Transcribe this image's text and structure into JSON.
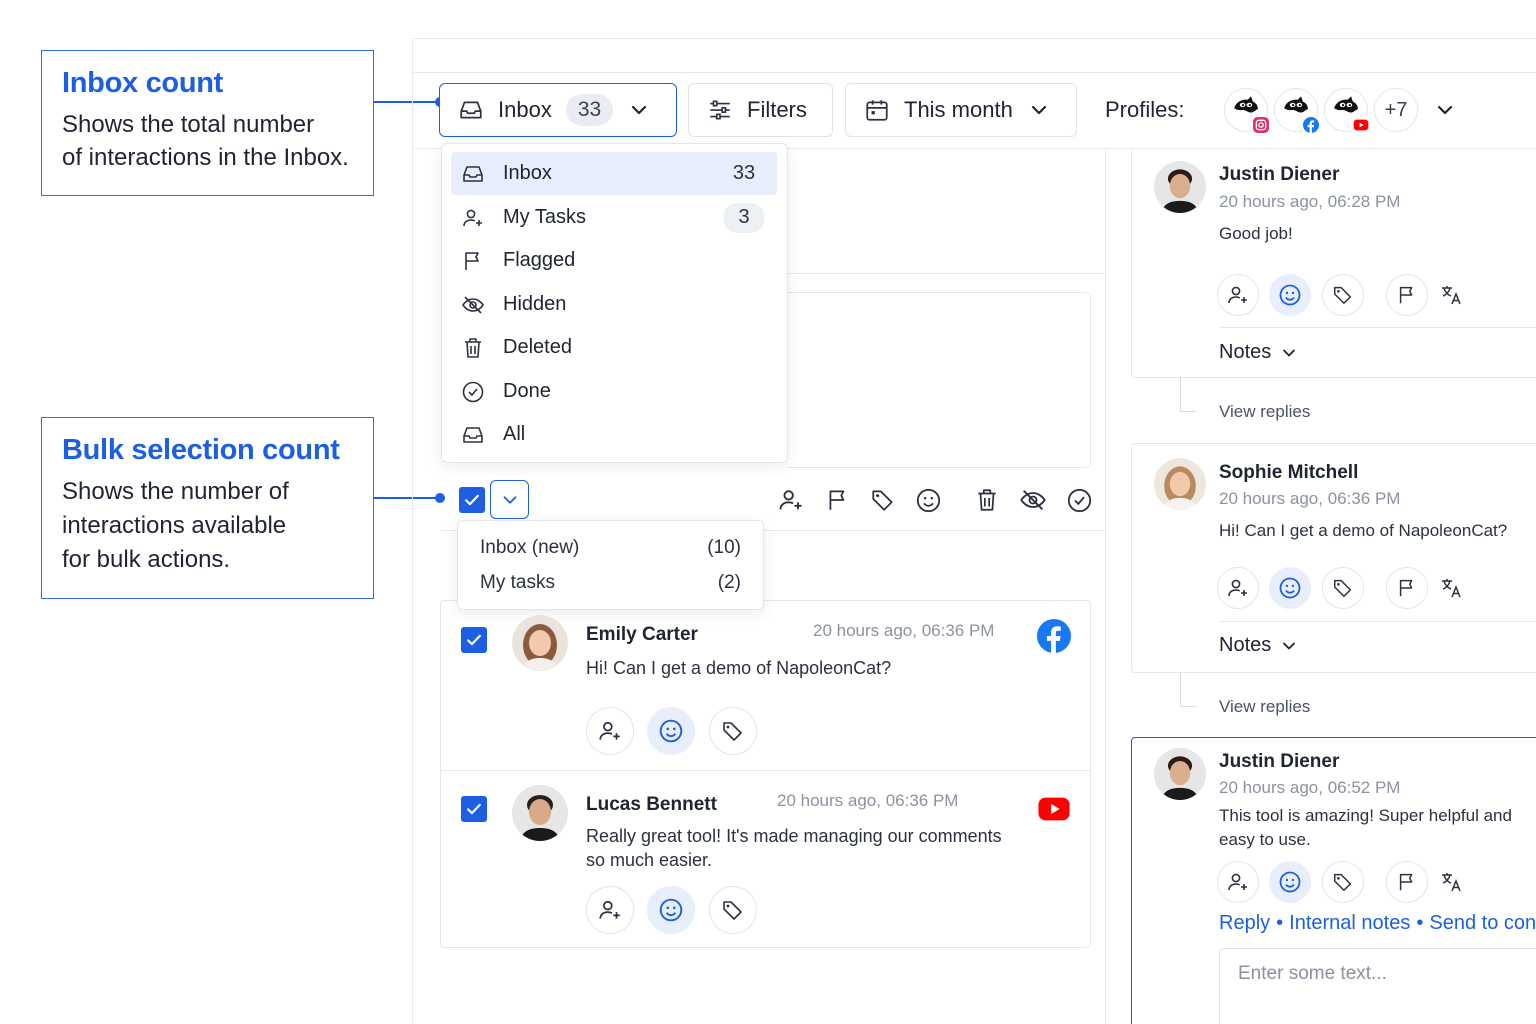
{
  "callouts": {
    "inbox_count": {
      "title": "Inbox count",
      "lines": [
        "Shows the total number",
        "of interactions in the Inbox."
      ]
    },
    "bulk_count": {
      "title": "Bulk selection count",
      "lines": [
        "Shows the number of",
        "interactions available",
        "for bulk actions."
      ]
    }
  },
  "toolbar": {
    "inbox_label": "Inbox",
    "inbox_count": "33",
    "filters_label": "Filters",
    "date_label": "This month",
    "profiles_label": "Profiles:",
    "profiles_more": "+7"
  },
  "inbox_menu": {
    "items": [
      {
        "label": "Inbox",
        "count": "33",
        "icon": "inbox-icon"
      },
      {
        "label": "My Tasks",
        "count": "3",
        "icon": "assign-user-icon"
      },
      {
        "label": "Flagged",
        "count": "",
        "icon": "flag-icon"
      },
      {
        "label": "Hidden",
        "count": "",
        "icon": "eye-off-icon"
      },
      {
        "label": "Deleted",
        "count": "",
        "icon": "trash-icon"
      },
      {
        "label": "Done",
        "count": "",
        "icon": "check-circle-icon"
      },
      {
        "label": "All",
        "count": "",
        "icon": "inbox-icon"
      }
    ]
  },
  "bulk_menu": {
    "items": [
      {
        "label": "Inbox (new)",
        "count": "(10)"
      },
      {
        "label": "My tasks",
        "count": "(2)"
      }
    ]
  },
  "list": [
    {
      "name": "Emily Carter",
      "time": "20 hours ago, 06:36 PM",
      "message": "Hi! Can I get a demo of NapoleonCat?",
      "platform": "facebook-icon"
    },
    {
      "name": "Lucas Bennett",
      "time": "20 hours ago, 06:36 PM",
      "message": "Really great tool! It's made managing our comments so much easier.",
      "platform": "youtube-icon"
    }
  ],
  "thread": [
    {
      "name": "Justin Diener",
      "time": "20 hours ago, 06:28 PM",
      "message": "Good job!",
      "notes": "Notes",
      "replies": "View replies"
    },
    {
      "name": "Sophie Mitchell",
      "time": "20 hours ago, 06:36 PM",
      "message": "Hi! Can I get a demo of NapoleonCat?",
      "notes": "Notes",
      "replies": "View replies"
    },
    {
      "name": "Justin Diener",
      "time": "20 hours ago, 06:52 PM",
      "message": "This tool is amazing! Super helpful and easy to use."
    }
  ],
  "reply": {
    "reply_link": "Reply",
    "notes_link": "Internal notes",
    "send_link": "Send to con",
    "placeholder": "Enter some text..."
  },
  "colors": {
    "accent": "#1d5fe3",
    "facebook": "#1877f2",
    "youtube": "#ff0000",
    "instagram": "#e1306c"
  }
}
